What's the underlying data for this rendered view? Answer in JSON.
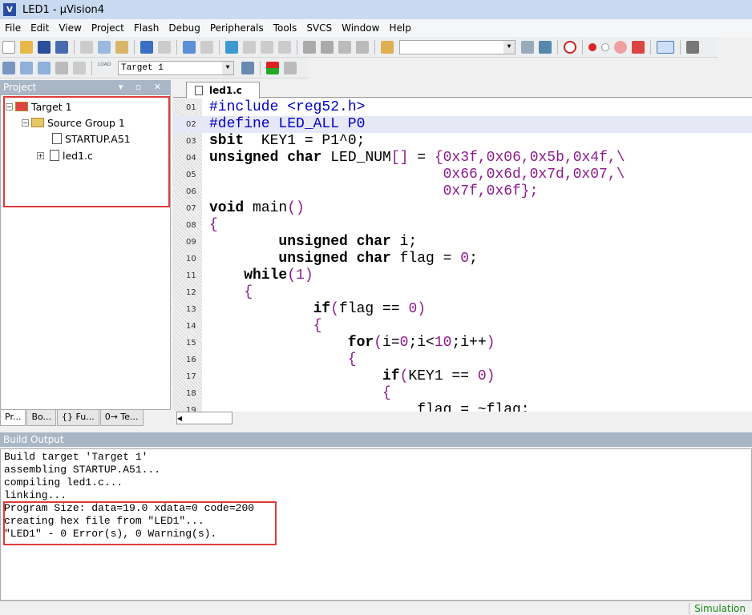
{
  "window": {
    "title": "LED1  - µVision4"
  },
  "menu": [
    "File",
    "Edit",
    "View",
    "Project",
    "Flash",
    "Debug",
    "Peripherals",
    "Tools",
    "SVCS",
    "Window",
    "Help"
  ],
  "toolbar": {
    "target_select": "Target 1",
    "load_label": "LOAD"
  },
  "project_panel": {
    "title": "Project",
    "tree": [
      {
        "label": "Target 1",
        "type": "target",
        "expanded": true
      },
      {
        "label": "Source Group 1",
        "type": "folder",
        "expanded": true
      },
      {
        "label": "STARTUP.A51",
        "type": "file"
      },
      {
        "label": "led1.c",
        "type": "file",
        "expandable": true
      }
    ],
    "tabs": [
      "Pr...",
      "Bo...",
      "{} Fu...",
      "0→ Te..."
    ]
  },
  "editor": {
    "tab": "led1.c",
    "highlighted_line": 2,
    "lines": [
      {
        "n": "01",
        "indent": 0,
        "t": [
          [
            "pp",
            "#include <reg52.h>"
          ]
        ]
      },
      {
        "n": "02",
        "indent": 0,
        "t": [
          [
            "pp",
            "#define LED_ALL P0"
          ]
        ]
      },
      {
        "n": "03",
        "indent": 0,
        "t": [
          [
            "kw",
            "sbit"
          ],
          [
            "",
            "  KEY1 = P1^0;"
          ]
        ]
      },
      {
        "n": "04",
        "indent": 0,
        "t": [
          [
            "kw",
            "unsigned char"
          ],
          [
            "",
            " LED_NUM"
          ],
          [
            "sym",
            "[]"
          ],
          [
            "",
            " = "
          ],
          [
            "num",
            "{0x3f,0x06,0x5b,0x4f,\\"
          ]
        ]
      },
      {
        "n": "05",
        "indent": 27,
        "t": [
          [
            "num",
            "0x66,0x6d,0x7d,0x07,\\"
          ]
        ]
      },
      {
        "n": "06",
        "indent": 27,
        "t": [
          [
            "num",
            "0x7f,0x6f};"
          ]
        ]
      },
      {
        "n": "07",
        "indent": 0,
        "t": [
          [
            "kw",
            "void"
          ],
          [
            "",
            " main"
          ],
          [
            "sym",
            "()"
          ]
        ]
      },
      {
        "n": "08",
        "indent": 0,
        "t": [
          [
            "sym",
            "{"
          ]
        ]
      },
      {
        "n": "09",
        "indent": 8,
        "t": [
          [
            "kw",
            "unsigned char"
          ],
          [
            "",
            " i;"
          ]
        ]
      },
      {
        "n": "10",
        "indent": 8,
        "t": [
          [
            "kw",
            "unsigned char"
          ],
          [
            "",
            " flag = "
          ],
          [
            "num",
            "0"
          ],
          [
            "",
            ";"
          ]
        ]
      },
      {
        "n": "11",
        "indent": 4,
        "t": [
          [
            "kw",
            "while"
          ],
          [
            "sym",
            "("
          ],
          [
            "num",
            "1"
          ],
          [
            "sym",
            ")"
          ]
        ]
      },
      {
        "n": "12",
        "indent": 4,
        "t": [
          [
            "sym",
            "{"
          ]
        ]
      },
      {
        "n": "13",
        "indent": 12,
        "t": [
          [
            "kw",
            "if"
          ],
          [
            "sym",
            "("
          ],
          [
            "",
            "flag == "
          ],
          [
            "num",
            "0"
          ],
          [
            "sym",
            ")"
          ]
        ]
      },
      {
        "n": "14",
        "indent": 12,
        "t": [
          [
            "sym",
            "{"
          ]
        ]
      },
      {
        "n": "15",
        "indent": 16,
        "t": [
          [
            "kw",
            "for"
          ],
          [
            "sym",
            "("
          ],
          [
            "",
            "i="
          ],
          [
            "num",
            "0"
          ],
          [
            "",
            ";i<"
          ],
          [
            "num",
            "10"
          ],
          [
            "",
            ";i++"
          ],
          [
            "sym",
            ")"
          ]
        ]
      },
      {
        "n": "16",
        "indent": 16,
        "t": [
          [
            "sym",
            "{"
          ]
        ]
      },
      {
        "n": "17",
        "indent": 20,
        "t": [
          [
            "kw",
            "if"
          ],
          [
            "sym",
            "("
          ],
          [
            "",
            "KEY1 == "
          ],
          [
            "num",
            "0"
          ],
          [
            "sym",
            ")"
          ]
        ]
      },
      {
        "n": "18",
        "indent": 20,
        "t": [
          [
            "sym",
            "{"
          ]
        ]
      },
      {
        "n": "19",
        "indent": 24,
        "t": [
          [
            "",
            "flag = ~flag;"
          ]
        ]
      }
    ]
  },
  "build_output": {
    "title": "Build Output",
    "lines": [
      "Build target 'Target 1'",
      "assembling STARTUP.A51...",
      "compiling led1.c...",
      "linking...",
      "Program Size: data=19.0 xdata=0 code=200",
      "creating hex file from \"LED1\"...",
      "\"LED1\" - 0 Error(s), 0 Warning(s)."
    ]
  },
  "status": {
    "mode": "Simulation"
  },
  "colors": {
    "annotation_box": "#e03a3a",
    "keyword": "#000000",
    "preprocessor": "#0000c0",
    "number": "#8b1a8b",
    "status_text": "#1a8a1a"
  }
}
